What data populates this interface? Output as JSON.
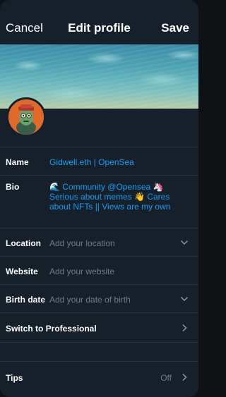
{
  "header": {
    "cancel_label": "Cancel",
    "title": "Edit profile",
    "save_label": "Save"
  },
  "fields": {
    "name": {
      "label": "Name",
      "value": "Gidwell.eth | OpenSea"
    },
    "bio": {
      "label": "Bio",
      "lines": [
        "🌊 Community @Opensea 🦄",
        "Serious about memes 👋 Cares",
        "about NFTs || Views are my own"
      ]
    },
    "location": {
      "label": "Location",
      "placeholder": "Add your location"
    },
    "website": {
      "label": "Website",
      "placeholder": "Add your website"
    },
    "birth_date": {
      "label": "Birth date",
      "placeholder": "Add your date of birth"
    },
    "professional": {
      "label": "Switch to Professional"
    },
    "tips": {
      "label": "Tips",
      "status": "Off"
    }
  },
  "icons": {
    "chevron_down": "chevron-down-icon",
    "chevron_right": "chevron-right-icon"
  },
  "colors": {
    "background": "#15202b",
    "accent": "#1d9bf0",
    "muted": "#6e7d8a",
    "avatar_bg": "#e06a2c"
  }
}
